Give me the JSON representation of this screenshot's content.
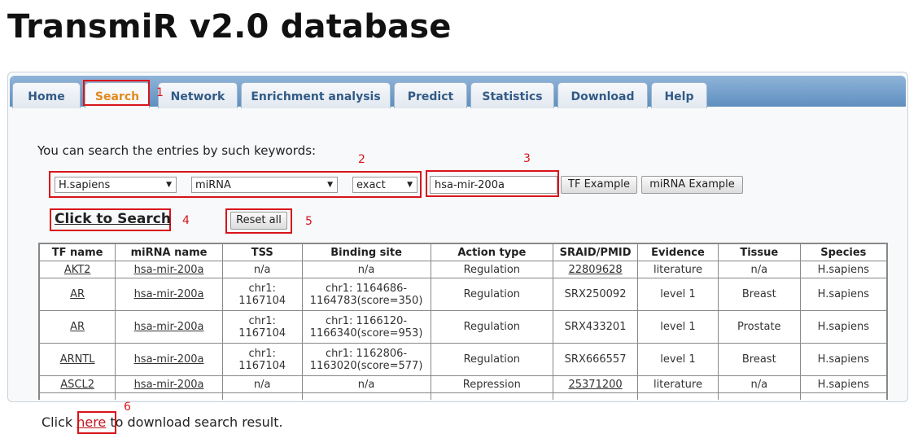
{
  "page": {
    "title": "TransmiR v2.0 database"
  },
  "nav": {
    "tabs": [
      {
        "label": "Home"
      },
      {
        "label": "Search"
      },
      {
        "label": "Network"
      },
      {
        "label": "Enrichment analysis"
      },
      {
        "label": "Predict"
      },
      {
        "label": "Statistics"
      },
      {
        "label": "Download"
      },
      {
        "label": "Help"
      }
    ]
  },
  "annotations": [
    "1",
    "2",
    "3",
    "4",
    "5",
    "6"
  ],
  "search": {
    "prompt": "You can search the entries by such keywords:",
    "species_select": "H.sapiens",
    "type_select": "miRNA",
    "match_select": "exact",
    "query_value": "hsa-mir-200a",
    "tf_example_label": "TF Example",
    "mirna_example_label": "miRNA Example",
    "click_to_search_label": "Click to Search",
    "reset_label": "Reset all"
  },
  "results": {
    "headers": [
      "TF name",
      "miRNA name",
      "TSS",
      "Binding site",
      "Action type",
      "SRAID/PMID",
      "Evidence",
      "Tissue",
      "Species"
    ],
    "rows": [
      {
        "tf": "AKT2",
        "mirna": "hsa-mir-200a",
        "tss": [
          "n/a"
        ],
        "binding": [
          "n/a"
        ],
        "action": "Regulation",
        "sraid": "22809628",
        "evidence": "literature",
        "tissue": "n/a",
        "species": "H.sapiens"
      },
      {
        "tf": "AR",
        "mirna": "hsa-mir-200a",
        "tss": [
          "chr1:",
          "1167104"
        ],
        "binding": [
          "chr1: 1164686-",
          "1164783(score=350)"
        ],
        "action": "Regulation",
        "sraid": "SRX250092",
        "evidence": "level 1",
        "tissue": "Breast",
        "species": "H.sapiens"
      },
      {
        "tf": "AR",
        "mirna": "hsa-mir-200a",
        "tss": [
          "chr1:",
          "1167104"
        ],
        "binding": [
          "chr1: 1166120-",
          "1166340(score=953)"
        ],
        "action": "Regulation",
        "sraid": "SRX433201",
        "evidence": "level 1",
        "tissue": "Prostate",
        "species": "H.sapiens"
      },
      {
        "tf": "ARNTL",
        "mirna": "hsa-mir-200a",
        "tss": [
          "chr1:",
          "1167104"
        ],
        "binding": [
          "chr1: 1162806-",
          "1163020(score=577)"
        ],
        "action": "Regulation",
        "sraid": "SRX666557",
        "evidence": "level 1",
        "tissue": "Breast",
        "species": "H.sapiens"
      },
      {
        "tf": "ASCL2",
        "mirna": "hsa-mir-200a",
        "tss": [
          "n/a"
        ],
        "binding": [
          "n/a"
        ],
        "action": "Repression",
        "sraid": "25371200",
        "evidence": "literature",
        "tissue": "n/a",
        "species": "H.sapiens"
      }
    ]
  },
  "footer": {
    "prefix": "Click ",
    "link": "here",
    "suffix": " to download search result."
  },
  "colors": {
    "annotation_red": "#d9141b",
    "nav_blue": "#5f8fbf",
    "active_tab": "#e08a1e"
  }
}
